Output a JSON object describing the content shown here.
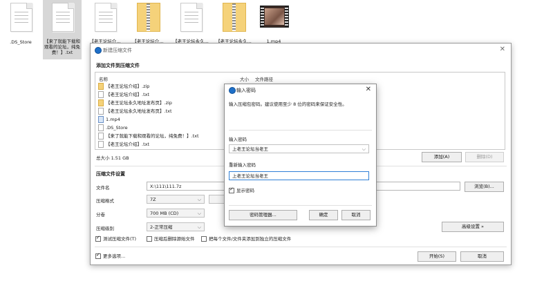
{
  "desktop": {
    "icons": [
      {
        "label": ".DS_Store",
        "type": "file",
        "selected": false
      },
      {
        "label": "【来了就能下载和观看的论坛，纯免费！】.txt",
        "type": "file",
        "selected": true
      },
      {
        "label": "【老王论坛介...",
        "type": "file",
        "selected": false
      },
      {
        "label": "【老王论坛介...",
        "type": "zip",
        "selected": false
      },
      {
        "label": "【老王论坛永久...",
        "type": "file",
        "selected": false
      },
      {
        "label": "【老王论坛永久...",
        "type": "zip",
        "selected": false
      },
      {
        "label": "1.mp4",
        "type": "video",
        "selected": false
      }
    ]
  },
  "main_window": {
    "title": "新建压缩文件",
    "add_section": "添加文件到压缩文件",
    "col_name": "名称",
    "col_size": "大小",
    "col_path": "文件路径",
    "files": [
      {
        "name": "【老王论坛介绍】.zip",
        "kind": "zip"
      },
      {
        "name": "【老王论坛介绍】.txt",
        "kind": "txt"
      },
      {
        "name": "【老王论坛永久地址发布页】.zip",
        "kind": "zip"
      },
      {
        "name": "【老王论坛永久地址发布页】.txt",
        "kind": "txt"
      },
      {
        "name": "1.mp4",
        "kind": "mp4"
      },
      {
        "name": ".DS_Store",
        "kind": "txt"
      },
      {
        "name": "【来了就能下载和观看的论坛，纯免费！】.txt",
        "kind": "txt"
      },
      {
        "name": "【老王论坛介绍】.txt",
        "kind": "txt"
      }
    ],
    "total_size": "总大小 1.51 GB",
    "add_button": "添加(A)",
    "delete_button": "删除(D)",
    "settings_section": "压缩文件设置",
    "filename_label": "文件名",
    "filename_value": "X:\\111\\111.7z",
    "browse_button": "浏览(B)...",
    "format_label": "压缩格式",
    "format_value": "7Z",
    "volume_label": "分卷",
    "volume_value": "700 MB (CD)",
    "level_label": "压缩级别",
    "level_value": "2-正常压缩",
    "advanced_button": "高级设置 »",
    "check_test": "测试压缩文件(T)",
    "check_delete": "压缩后删除源始文件",
    "check_each": "把每个文件/文件夹添加到独立的压缩文件",
    "more_options": "更多选项...",
    "start_button": "开始(S)",
    "cancel_button": "取消"
  },
  "password_dialog": {
    "title": "输入密码",
    "hint": "输入压缩包密码。建议使用至少 8 位的密码来保证安全性。",
    "pw_label": "输入密码",
    "pw_value": "上老王论坛当老王",
    "pw_again_label": "重新输入密码",
    "pw_again_value": "上老王论坛当老王",
    "show_pw": "显示密码",
    "manager_button": "密码管理器...",
    "ok_button": "确定",
    "cancel_button": "取消"
  },
  "colors": {
    "accent": "#1e6fc8",
    "focus_border": "#2f7fd6"
  }
}
